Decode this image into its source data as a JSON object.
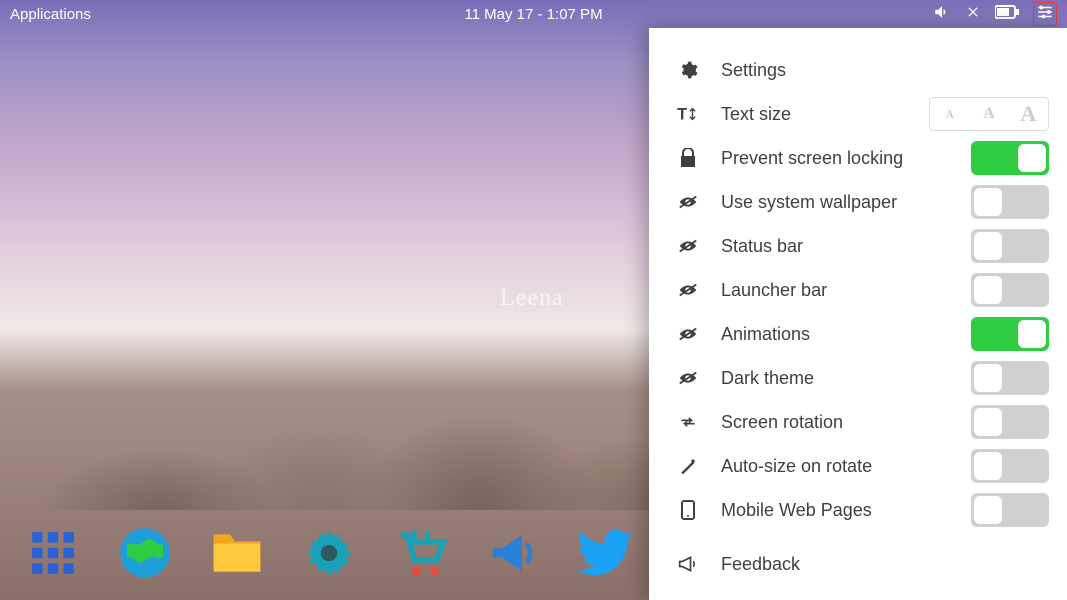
{
  "topbar": {
    "applications": "Applications",
    "datetime": "11 May 17 - 1:07 PM"
  },
  "watermark": "Leena",
  "panel": {
    "header": "Settings",
    "textSize": "Text size",
    "preventLock": "Prevent screen locking",
    "systemWallpaper": "Use system wallpaper",
    "statusBar": "Status bar",
    "launcherBar": "Launcher bar",
    "animations": "Animations",
    "darkTheme": "Dark theme",
    "screenRotation": "Screen rotation",
    "autoSize": "Auto-size on rotate",
    "mobileWeb": "Mobile Web Pages",
    "feedback": "Feedback"
  },
  "toggles": {
    "preventLock": true,
    "systemWallpaper": false,
    "statusBar": false,
    "launcherBar": false,
    "animations": true,
    "darkTheme": false,
    "screenRotation": false,
    "autoSize": false,
    "mobileWeb": false
  },
  "dock": {
    "items": [
      "apps-grid",
      "globe",
      "folder",
      "settings-gear",
      "shopping-cart",
      "megaphone",
      "twitter"
    ]
  }
}
